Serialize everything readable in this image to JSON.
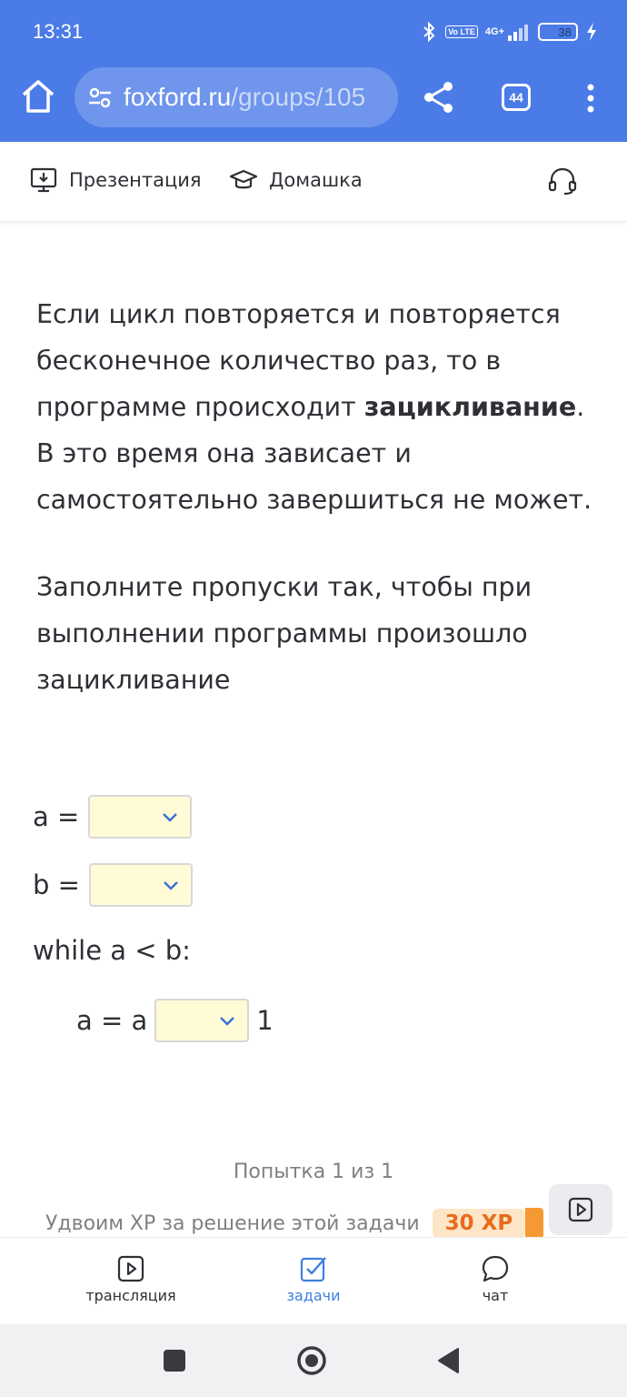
{
  "status_bar": {
    "time": "13:31",
    "network": "4G+",
    "volte": "Vo LTE",
    "battery": "38"
  },
  "browser": {
    "url_domain": "foxford.ru",
    "url_path": "/groups/105",
    "tab_count": "44"
  },
  "top_nav": {
    "presentation_label": "Презентация",
    "homework_label": "Домашка"
  },
  "task": {
    "para1_part1": "Если цикл повторяется и повторяется бесконечное количество раз, то в программе происходит ",
    "para1_bold": "зацикливание",
    "para1_part2": ". В это время она зависает и самостоятельно завершиться не может.",
    "para2": "Заполните пропуски так, чтобы при выполнении программы произошло зацикливание",
    "code": {
      "line1_prefix": "a =",
      "line2_prefix": "b =",
      "line3": "while a < b:",
      "line4_prefix": "a = a",
      "line4_suffix": "1"
    }
  },
  "footer": {
    "attempt": "Попытка 1 из 1",
    "xp_text": "Удвоим XP за решение этой задачи",
    "xp_badge": "30 XP"
  },
  "bottom_tabs": [
    {
      "label": "трансляция",
      "icon": "play-square-icon"
    },
    {
      "label": "задачи",
      "icon": "checkbox-icon",
      "active": true
    },
    {
      "label": "чат",
      "icon": "chat-bubble-icon"
    }
  ],
  "colors": {
    "chrome_blue": "#4b7be6",
    "accent_blue": "#3e7ee0",
    "dropdown_bg": "#fffbd6",
    "xp_orange": "#e96b1a"
  }
}
